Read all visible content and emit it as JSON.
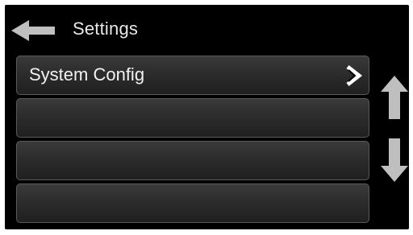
{
  "header": {
    "title": "Settings",
    "back_icon": "left-arrow-icon"
  },
  "list": {
    "items": [
      {
        "label": "System Config",
        "icon": "chevron-right-icon"
      },
      {
        "label": ""
      },
      {
        "label": ""
      },
      {
        "label": ""
      }
    ]
  },
  "scroll": {
    "up_icon": "up-arrow-icon",
    "down_icon": "down-arrow-icon"
  },
  "colors": {
    "background": "#000000",
    "row_fill": "#2c2c2c",
    "row_border": "#5a5a5a",
    "text": "#f2f2f2",
    "icon": "#bfbfbf"
  }
}
